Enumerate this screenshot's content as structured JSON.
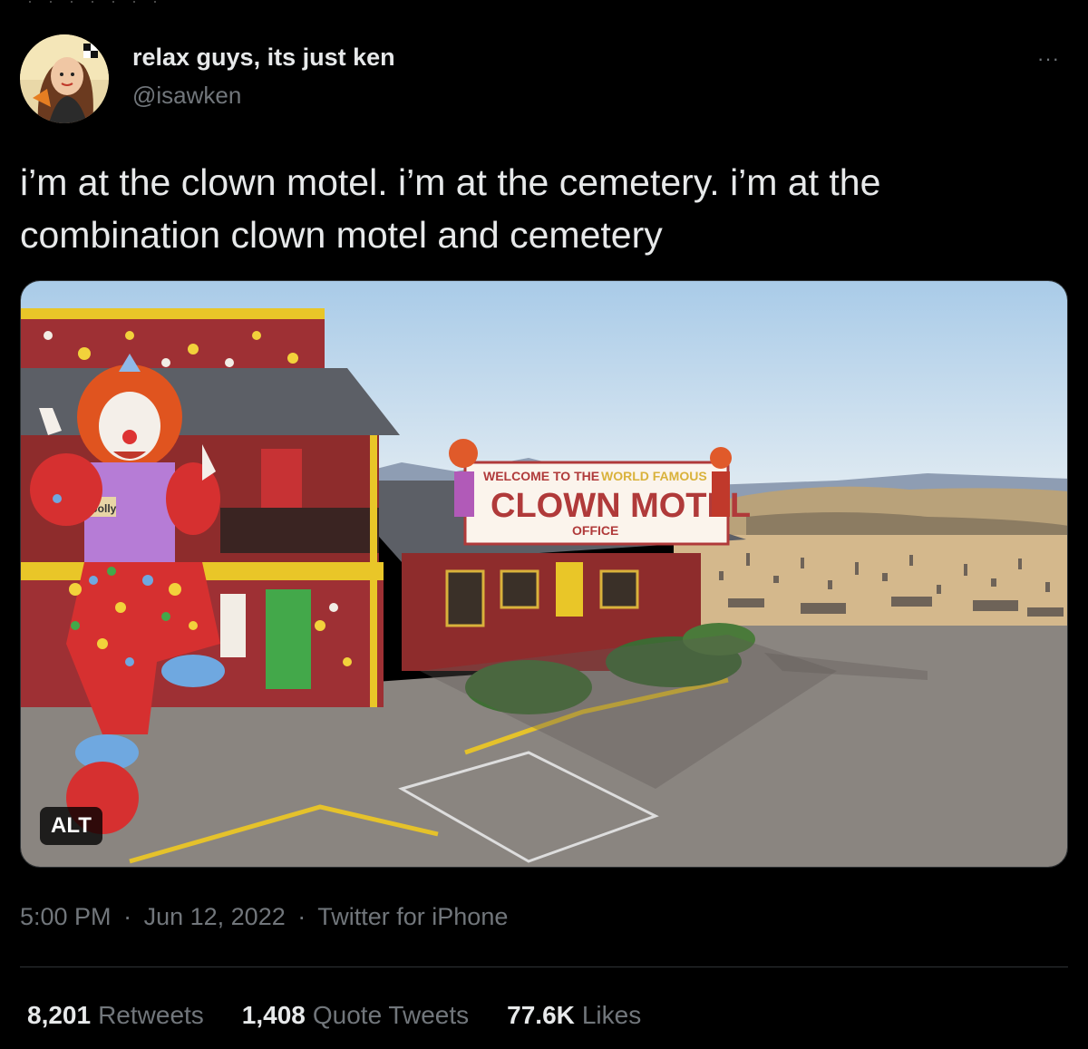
{
  "author": {
    "display_name": "relax guys, its just ken",
    "handle": "@isawken",
    "avatar_icon": "avatar-photo"
  },
  "menu": {
    "more_label": "···",
    "icon": "more-dots-icon"
  },
  "tweet": {
    "text": "i’m at the clown motel. i’m at the cemetery. i’m at the combination clown motel and cemetery"
  },
  "media": {
    "alt_label": "ALT",
    "sign": {
      "line1": "WELCOME TO THE",
      "line1b": "WORLD FAMOUS",
      "line2": "CLOWN MOTEL",
      "line3": "OFFICE"
    },
    "clown_tag": "Jolly"
  },
  "meta": {
    "time": "5:00 PM",
    "date": "Jun 12, 2022",
    "source": "Twitter for iPhone",
    "separator": "·"
  },
  "stats": {
    "retweets": {
      "count": "8,201",
      "label": "Retweets"
    },
    "quotes": {
      "count": "1,408",
      "label": "Quote Tweets"
    },
    "likes": {
      "count": "77.6K",
      "label": "Likes"
    }
  },
  "colors": {
    "background": "#000000",
    "text_primary": "#e7e9ea",
    "text_secondary": "#71767b",
    "border": "#2f3336"
  }
}
